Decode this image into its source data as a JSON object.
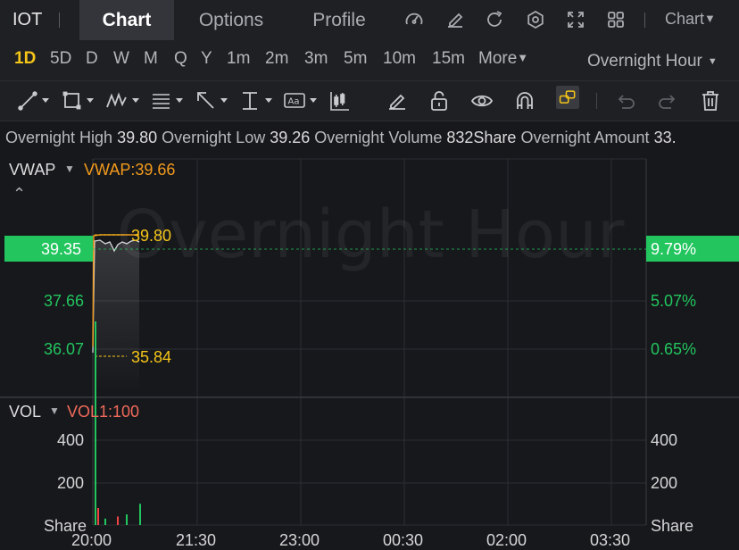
{
  "header": {
    "symbol": "IOT",
    "tabs": [
      "Chart",
      "Options",
      "Profile"
    ],
    "active_tab": "Chart",
    "chart_menu_label": "Chart",
    "icons": [
      "speedometer-icon",
      "edit-icon",
      "refresh-icon",
      "settings-icon",
      "fullscreen-icon",
      "grid-layout-icon"
    ]
  },
  "periods": {
    "items": [
      "1D",
      "5D",
      "D",
      "W",
      "M",
      "Q",
      "Y",
      "1m",
      "2m",
      "3m",
      "5m",
      "10m",
      "15m",
      "More"
    ],
    "active": "1D",
    "session": "Overnight Hour"
  },
  "tools": [
    "trend-line-icon",
    "rectangle-icon",
    "pattern-icon",
    "fib-icon",
    "arrow-icon",
    "text-measure-icon",
    "text-label-icon",
    "candle-tool-icon",
    "pencil-icon",
    "lock-icon",
    "eye-icon",
    "magnet-icon",
    "link-icon",
    "undo-icon",
    "redo-icon",
    "trash-icon"
  ],
  "info": {
    "high_label": "Overnight High",
    "high_value": "39.80",
    "low_label": "Overnight Low",
    "low_value": "39.26",
    "volume_label": "Overnight Volume",
    "volume_value": "832Share",
    "amount_label": "Overnight Amount",
    "amount_value": "33."
  },
  "price_panel": {
    "indicator": "VWAP",
    "indicator_value": "VWAP:39.66",
    "watermark": "Overnight Hour",
    "current_price": "39.35",
    "current_pct": "9.79%",
    "left_axis": [
      "37.66",
      "36.07"
    ],
    "right_axis": [
      "5.07%",
      "0.65%"
    ],
    "high_marker": "39.80",
    "low_marker": "35.84"
  },
  "volume_panel": {
    "indicator": "VOL",
    "indicator_value": "VOL1:100",
    "left_axis": [
      "400",
      "200",
      "Share"
    ],
    "right_axis": [
      "400",
      "200",
      "Share"
    ]
  },
  "time_axis": [
    "20:00",
    "21:30",
    "23:00",
    "00:30",
    "02:00",
    "03:30"
  ],
  "colors": {
    "up": "#22c55e",
    "down": "#ef4444",
    "accent": "#f5c518",
    "vwap": "#f29a1c"
  },
  "chart_data": {
    "type": "line",
    "title": "",
    "x": [
      "20:00",
      "21:30",
      "23:00",
      "00:30",
      "02:00",
      "03:30"
    ],
    "price_high": 39.8,
    "price_low": 35.84,
    "last_price": 39.35,
    "vwap": 39.66,
    "y_ticks": [
      37.66,
      36.07
    ],
    "volume_ticks": [
      400,
      200
    ],
    "volume_bars": [
      {
        "dir": "up",
        "value": 480
      },
      {
        "dir": "down",
        "value": 40
      },
      {
        "dir": "up",
        "value": 15
      },
      {
        "dir": "down",
        "value": 20
      },
      {
        "dir": "up",
        "value": 25
      },
      {
        "dir": "up",
        "value": 50
      }
    ]
  }
}
